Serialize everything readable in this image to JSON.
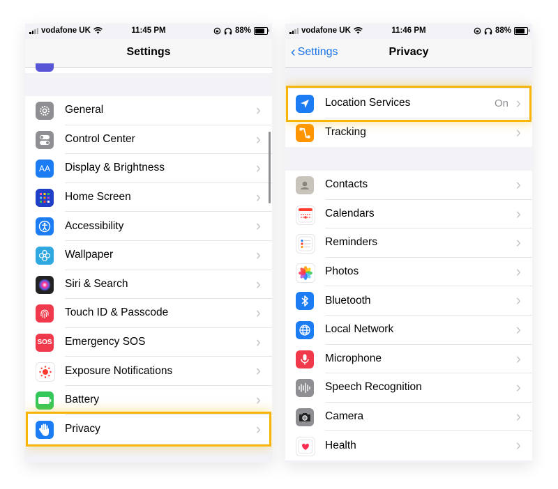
{
  "left": {
    "status": {
      "carrier": "vodafone UK",
      "time": "11:45 PM",
      "battery": "88%"
    },
    "nav": {
      "title": "Settings"
    },
    "items": [
      {
        "label": "General",
        "icon": "gear-icon",
        "color": "#8e8e93"
      },
      {
        "label": "Control Center",
        "icon": "toggle-icon",
        "color": "#8e8e93"
      },
      {
        "label": "Display & Brightness",
        "icon": "text-size-icon",
        "color": "#1c7cf4"
      },
      {
        "label": "Home Screen",
        "icon": "home-grid-icon",
        "color": "#1e3fc6"
      },
      {
        "label": "Accessibility",
        "icon": "accessibility-icon",
        "color": "#1c7cf4"
      },
      {
        "label": "Wallpaper",
        "icon": "flower-icon",
        "color": "#2fa7e0"
      },
      {
        "label": "Siri & Search",
        "icon": "siri-icon",
        "color": "#222"
      },
      {
        "label": "Touch ID & Passcode",
        "icon": "fingerprint-icon",
        "color": "#f0394b"
      },
      {
        "label": "Emergency SOS",
        "icon": "sos-icon",
        "color": "#f0394b",
        "glyph": "SOS"
      },
      {
        "label": "Exposure Notifications",
        "icon": "exposure-icon",
        "color": "#ffffff"
      },
      {
        "label": "Battery",
        "icon": "battery-icon",
        "color": "#34c759"
      },
      {
        "label": "Privacy",
        "icon": "hand-icon",
        "color": "#1c7cf4"
      }
    ]
  },
  "right": {
    "status": {
      "carrier": "vodafone UK",
      "time": "11:46 PM",
      "battery": "88%"
    },
    "nav": {
      "title": "Privacy",
      "back": "Settings"
    },
    "top_items": [
      {
        "label": "Location Services",
        "value": "On",
        "icon": "location-arrow-icon",
        "color": "#1c7cf4"
      },
      {
        "label": "Tracking",
        "icon": "tracking-icon",
        "color": "#ff9500"
      }
    ],
    "items": [
      {
        "label": "Contacts",
        "icon": "contacts-icon",
        "color": "#c8c4bc"
      },
      {
        "label": "Calendars",
        "icon": "calendar-icon",
        "color": "#ffffff"
      },
      {
        "label": "Reminders",
        "icon": "reminders-icon",
        "color": "#ffffff"
      },
      {
        "label": "Photos",
        "icon": "photos-icon",
        "color": "#ffffff"
      },
      {
        "label": "Bluetooth",
        "icon": "bluetooth-icon",
        "color": "#1c7cf4"
      },
      {
        "label": "Local Network",
        "icon": "globe-icon",
        "color": "#1c7cf4"
      },
      {
        "label": "Microphone",
        "icon": "microphone-icon",
        "color": "#f0394b"
      },
      {
        "label": "Speech Recognition",
        "icon": "waveform-icon",
        "color": "#8e8e93"
      },
      {
        "label": "Camera",
        "icon": "camera-icon",
        "color": "#8e8e93"
      },
      {
        "label": "Health",
        "icon": "heart-icon",
        "color": "#ffffff"
      }
    ]
  },
  "highlight_color": "#f5b50a"
}
